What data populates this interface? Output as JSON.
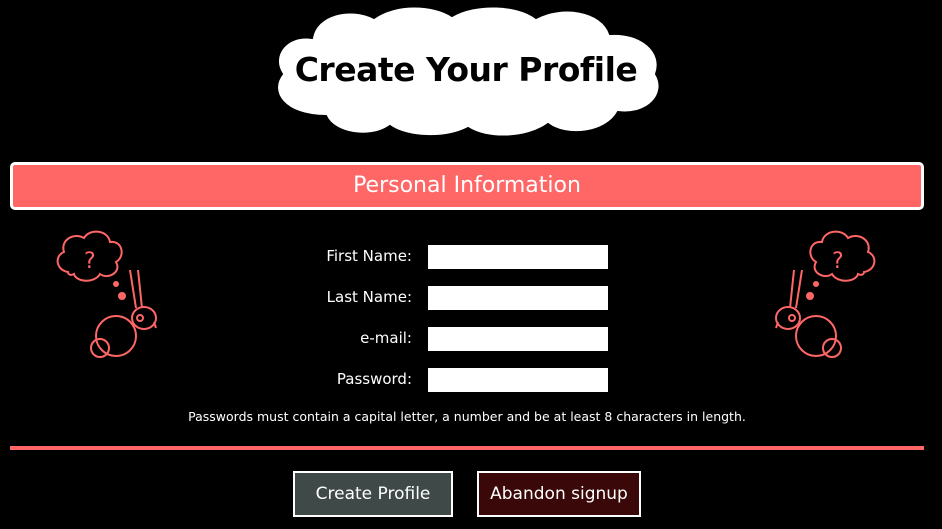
{
  "header": {
    "title": "Create Your Profile"
  },
  "section": {
    "title": "Personal Information"
  },
  "form": {
    "fields": [
      {
        "label": "First Name:",
        "value": ""
      },
      {
        "label": "Last Name:",
        "value": ""
      },
      {
        "label": "e-mail:",
        "value": ""
      },
      {
        "label": "Password:",
        "value": ""
      }
    ],
    "hint": "Passwords must contain a capital letter, a number and be at least 8 characters in length."
  },
  "actions": {
    "create_label": "Create Profile",
    "abandon_label": "Abandon signup"
  },
  "colors": {
    "accent": "#ff6666",
    "background": "#000000",
    "create_button": "#3f4a48",
    "abandon_button": "#3a0808"
  },
  "decorations": {
    "left_icon": "confused-rabbit-icon",
    "right_icon": "confused-rabbit-icon"
  }
}
